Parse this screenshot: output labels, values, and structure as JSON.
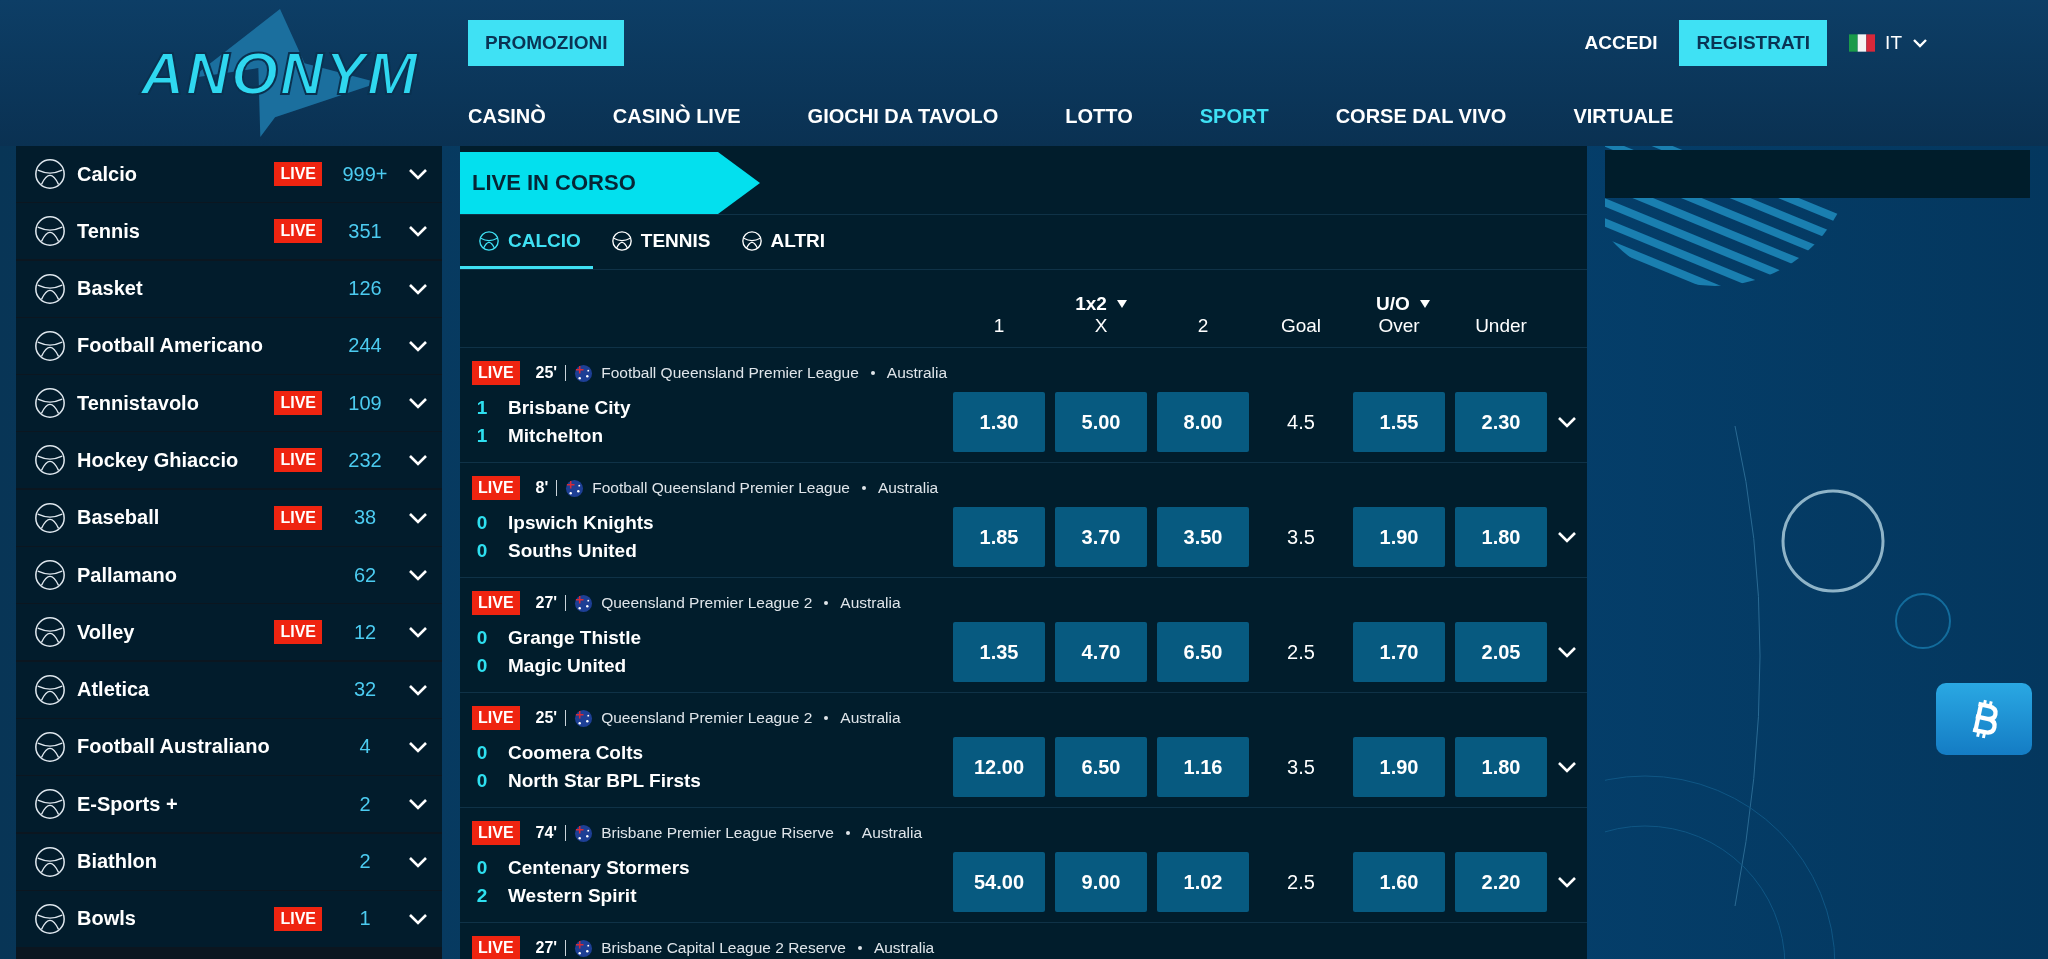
{
  "header": {
    "logo_text": "ANONYM",
    "promo_button": "PROMOZIONI",
    "nav": [
      {
        "label": "CASINÒ",
        "selected": false
      },
      {
        "label": "CASINÒ LIVE",
        "selected": false
      },
      {
        "label": "GIOCHI DA TAVOLO",
        "selected": false
      },
      {
        "label": "LOTTO",
        "selected": false
      },
      {
        "label": "SPORT",
        "selected": true
      },
      {
        "label": "CORSE DAL VIVO",
        "selected": false
      },
      {
        "label": "VIRTUALE",
        "selected": false
      }
    ],
    "login": "ACCEDI",
    "register": "REGISTRATI",
    "language": "IT"
  },
  "sidebar": {
    "sports": [
      {
        "name": "Calcio",
        "live_badge": "LIVE",
        "count": "999+"
      },
      {
        "name": "Tennis",
        "live_badge": "LIVE",
        "count": "351"
      },
      {
        "name": "Basket",
        "count": "126"
      },
      {
        "name": "Football Americano",
        "count": "244"
      },
      {
        "name": "Tennistavolo",
        "live_badge": "LIVE",
        "count": "109"
      },
      {
        "name": "Hockey Ghiaccio",
        "live_badge": "LIVE",
        "count": "232"
      },
      {
        "name": "Baseball",
        "live_badge": "LIVE",
        "count": "38"
      },
      {
        "name": "Pallamano",
        "count": "62"
      },
      {
        "name": "Volley",
        "live_badge": "LIVE",
        "count": "12"
      },
      {
        "name": "Atletica",
        "count": "32"
      },
      {
        "name": "Football Australiano",
        "count": "4"
      },
      {
        "name": "E-Sports +",
        "count": "2"
      },
      {
        "name": "Biathlon",
        "count": "2"
      },
      {
        "name": "Bowls",
        "live_badge": "LIVE",
        "count": "1"
      }
    ]
  },
  "live_section": {
    "title": "LIVE IN CORSO",
    "tabs": [
      {
        "label": "CALCIO",
        "selected": true
      },
      {
        "label": "TENNIS",
        "selected": false
      },
      {
        "label": "ALTRI",
        "selected": false
      }
    ],
    "markets": [
      {
        "label": "1x2",
        "columns": [
          "1",
          "X",
          "2"
        ]
      },
      {
        "label": "U/O",
        "columns": [
          "Goal",
          "Over",
          "Under"
        ]
      }
    ],
    "matches": [
      {
        "live_badge": "LIVE",
        "minute": "25'",
        "league": "Football Queensland Premier League",
        "country": "Australia",
        "teams": [
          {
            "score": "1",
            "name": "Brisbane City"
          },
          {
            "score": "1",
            "name": "Mitchelton"
          }
        ],
        "odds_1x2": [
          "1.30",
          "5.00",
          "8.00"
        ],
        "goal_line": "4.5",
        "odds_ou": [
          "1.55",
          "2.30"
        ]
      },
      {
        "live_badge": "LIVE",
        "minute": "8'",
        "league": "Football Queensland Premier League",
        "country": "Australia",
        "teams": [
          {
            "score": "0",
            "name": "Ipswich Knights"
          },
          {
            "score": "0",
            "name": "Souths United"
          }
        ],
        "odds_1x2": [
          "1.85",
          "3.70",
          "3.50"
        ],
        "goal_line": "3.5",
        "odds_ou": [
          "1.90",
          "1.80"
        ]
      },
      {
        "live_badge": "LIVE",
        "minute": "27'",
        "league": "Queensland Premier League 2",
        "country": "Australia",
        "teams": [
          {
            "score": "0",
            "name": "Grange Thistle"
          },
          {
            "score": "0",
            "name": "Magic United"
          }
        ],
        "odds_1x2": [
          "1.35",
          "4.70",
          "6.50"
        ],
        "goal_line": "2.5",
        "odds_ou": [
          "1.70",
          "2.05"
        ]
      },
      {
        "live_badge": "LIVE",
        "minute": "25'",
        "league": "Queensland Premier League 2",
        "country": "Australia",
        "teams": [
          {
            "score": "0",
            "name": "Coomera Colts"
          },
          {
            "score": "0",
            "name": "North Star BPL Firsts"
          }
        ],
        "odds_1x2": [
          "12.00",
          "6.50",
          "1.16"
        ],
        "goal_line": "3.5",
        "odds_ou": [
          "1.90",
          "1.80"
        ]
      },
      {
        "live_badge": "LIVE",
        "minute": "74'",
        "league": "Brisbane Premier League Riserve",
        "country": "Australia",
        "teams": [
          {
            "score": "0",
            "name": "Centenary Stormers"
          },
          {
            "score": "2",
            "name": "Western Spirit"
          }
        ],
        "odds_1x2": [
          "54.00",
          "9.00",
          "1.02"
        ],
        "goal_line": "2.5",
        "odds_ou": [
          "1.60",
          "2.20"
        ]
      },
      {
        "live_badge": "LIVE",
        "minute": "27'",
        "league": "Brisbane Capital League 2 Reserve",
        "country": "Australia"
      }
    ]
  }
}
